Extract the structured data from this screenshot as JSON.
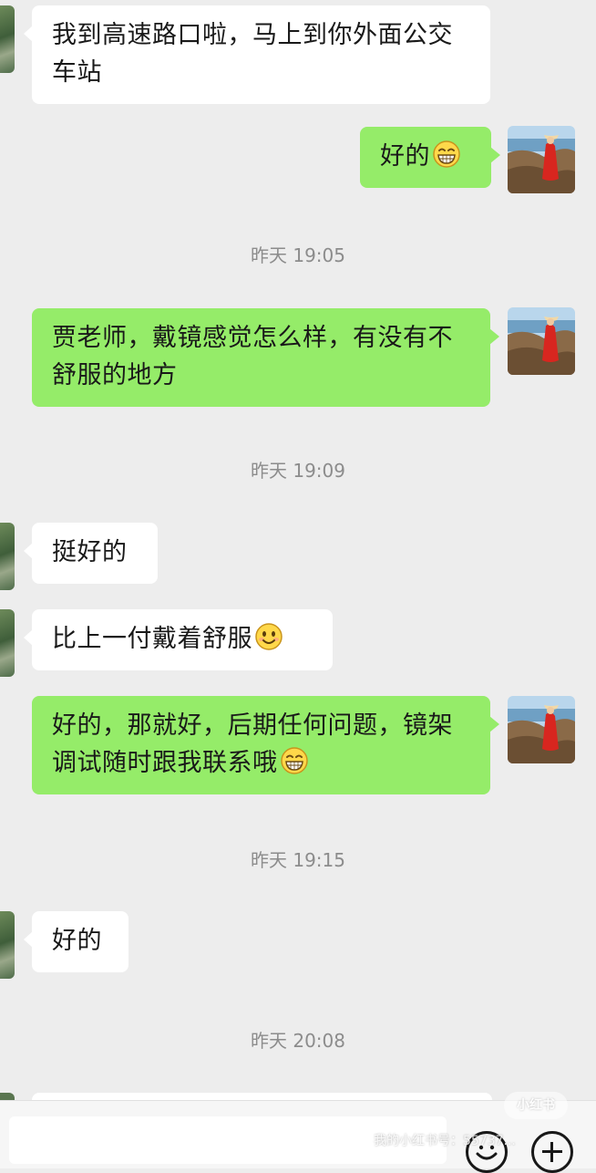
{
  "messages": {
    "m1": {
      "text": "我到高速路口啦，马上到你外面公交车站"
    },
    "m2": {
      "text": "好的",
      "emoji": "grin-emoji"
    },
    "t1": "昨天 19:05",
    "m3": {
      "text": "贾老师，戴镜感觉怎么样，有没有不舒服的地方"
    },
    "t2": "昨天 19:09",
    "m4": {
      "text": "挺好的"
    },
    "m5": {
      "text": "比上一付戴着舒服",
      "emoji": "smile-emoji"
    },
    "m6": {
      "text": "好的，那就好，后期任何问题，镜架调试随时跟我联系哦",
      "emoji": "grin-emoji"
    },
    "t3": "昨天 19:15",
    "m7": {
      "text": "好的"
    },
    "t4": "昨天 20:08"
  },
  "input_bar": {
    "icons": [
      "emoji-face-icon",
      "plus-icon"
    ]
  },
  "overlay": {
    "watermark_text": "我的小红书号：55737...",
    "logo_text": "小红书"
  },
  "colors": {
    "background": "#ededed",
    "incoming_bubble": "#ffffff",
    "outgoing_bubble": "#95ec69",
    "timestamp": "#8c8c8c"
  }
}
